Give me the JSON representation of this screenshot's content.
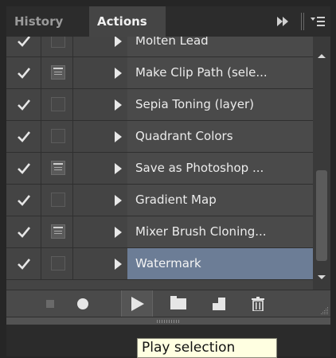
{
  "tabs": [
    {
      "label": "History",
      "active": false
    },
    {
      "label": "Actions",
      "active": true
    }
  ],
  "actions": [
    {
      "name": "Molten Lead",
      "enabled": true,
      "dialog": false,
      "selected": false
    },
    {
      "name": "Make Clip Path (sele...",
      "enabled": true,
      "dialog": true,
      "selected": false
    },
    {
      "name": "Sepia Toning (layer)",
      "enabled": true,
      "dialog": false,
      "selected": false
    },
    {
      "name": "Quadrant Colors",
      "enabled": true,
      "dialog": false,
      "selected": false
    },
    {
      "name": "Save as Photoshop ...",
      "enabled": true,
      "dialog": true,
      "selected": false
    },
    {
      "name": "Gradient Map",
      "enabled": true,
      "dialog": false,
      "selected": false
    },
    {
      "name": "Mixer Brush Cloning...",
      "enabled": true,
      "dialog": true,
      "selected": false
    },
    {
      "name": "Watermark",
      "enabled": true,
      "dialog": false,
      "selected": true
    }
  ],
  "toolbar": {
    "buttons": [
      "stop-playing-button",
      "record-button",
      "play-selection-button",
      "new-set-button",
      "new-action-button",
      "delete-button"
    ]
  },
  "tooltip": {
    "text": "Play selection"
  },
  "colors": {
    "selected_row": "#6c7d96",
    "tooltip_bg": "#ffffe1"
  }
}
